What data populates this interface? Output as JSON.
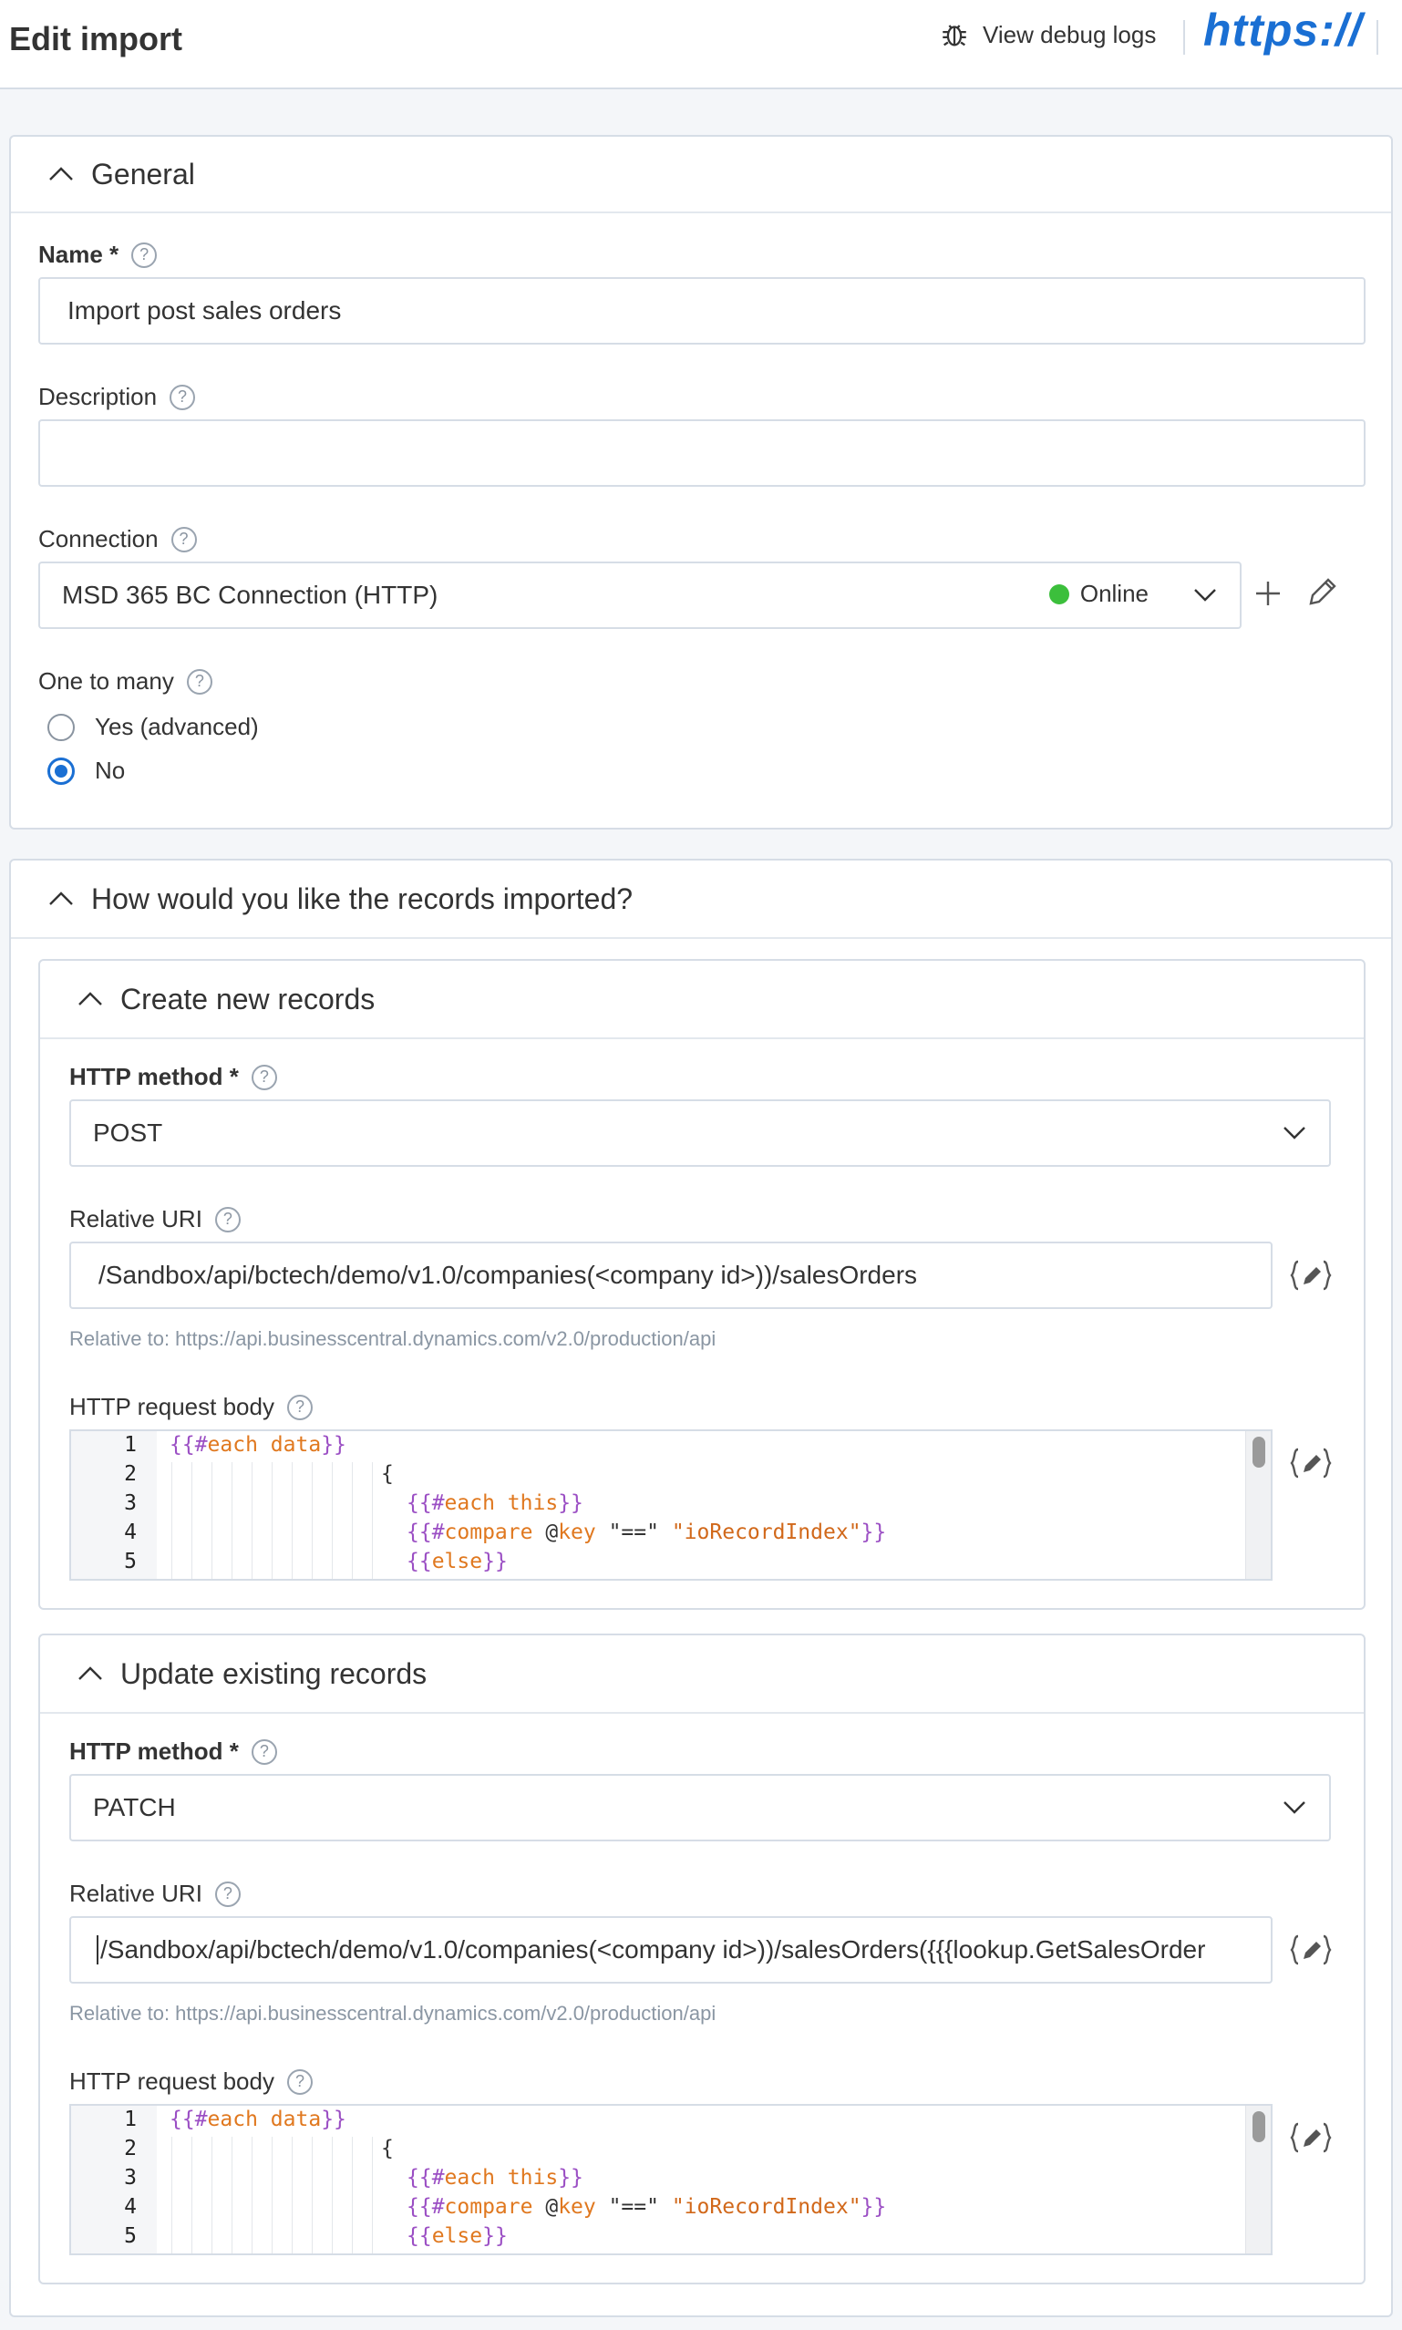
{
  "header": {
    "title": "Edit import",
    "debug_label": "View debug logs",
    "logo_text": "https://"
  },
  "general": {
    "section_title": "General",
    "name": {
      "label": "Name *",
      "value": "Import post sales orders"
    },
    "description": {
      "label": "Description",
      "value": ""
    },
    "connection": {
      "label": "Connection",
      "value": "MSD 365 BC Connection (HTTP)",
      "status": "Online"
    },
    "one_to_many": {
      "label": "One to many",
      "options": [
        "Yes (advanced)",
        "No"
      ],
      "selected": "No"
    }
  },
  "records": {
    "section_title": "How would you like the records imported?",
    "create": {
      "title": "Create new records",
      "method_label": "HTTP method *",
      "method_value": "POST",
      "uri_label": "Relative URI",
      "uri_value": "/Sandbox/api/bctech/demo/v1.0/companies(<company id>))/salesOrders",
      "uri_hint": "Relative to: https://api.businesscentral.dynamics.com/v2.0/production/api",
      "body_label": "HTTP request body"
    },
    "update": {
      "title": "Update existing records",
      "method_label": "HTTP method *",
      "method_value": "PATCH",
      "uri_label": "Relative URI",
      "uri_value": "/Sandbox/api/bctech/demo/v1.0/companies(<company id>))/salesOrders({{{lookup.GetSalesOrder",
      "uri_hint": "Relative to: https://api.businesscentral.dynamics.com/v2.0/production/api",
      "body_label": "HTTP request body"
    },
    "code_lines": {
      "n1": "1",
      "n2": "2",
      "n3": "3",
      "n4": "4",
      "n5": "5",
      "l1_open": "{{#",
      "l1_kw": "each",
      "l1_arg": " data",
      "l1_close": "}}",
      "l2": "{",
      "l3_open": "{{#",
      "l3_kw": "each",
      "l3_arg": " this",
      "l3_close": "}}",
      "l4_open": "{{#",
      "l4_kw": "compare",
      "l4_at": " @",
      "l4_key": "key",
      "l4_op": " \"==\" ",
      "l4_str": "\"ioRecordIndex\"",
      "l4_close": "}}",
      "l5_open": "{{",
      "l5_kw": "else",
      "l5_close": "}}"
    }
  },
  "colors": {
    "accent": "#1a6fd3",
    "online": "#3cbf3c",
    "handlebars": "#9b4fc4",
    "keyword": "#e0781f"
  }
}
